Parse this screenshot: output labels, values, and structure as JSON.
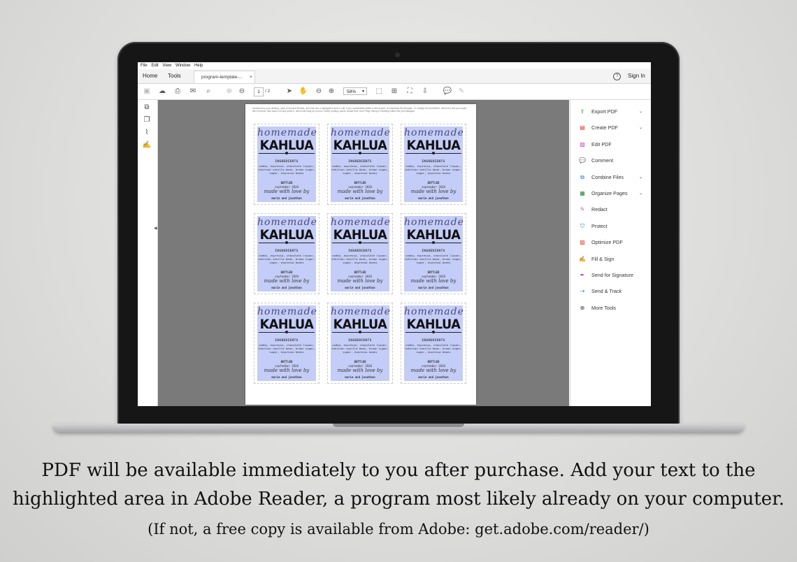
{
  "menu": [
    "File",
    "Edit",
    "View",
    "Window",
    "Help"
  ],
  "tabs": {
    "home": "Home",
    "tools": "Tools",
    "doc": "program-template-...",
    "close": "×"
  },
  "header": {
    "sign_in": "Sign In",
    "help": "?"
  },
  "toolbar": {
    "page_current": "1",
    "page_total": "/ 2",
    "zoom": "58%"
  },
  "page_instructions": "Download to your desktop, open in Acrobat Reader, and click into a highlighted area to edit. If you accidentally delete a font accent, re-download the template. To change the font/theme, select the text you would like to format, hold down Ctrl and press E, which will bring up a menu. When printing, select 'Actual Size' from 'Page Sizing & Handling' within the print dialogue.",
  "label": {
    "script": "homemade",
    "title": "KAHLUA",
    "ingredients_heading": "INGREDIENTS",
    "ingredients": "vodka, espresso, chocolate liquor, tahitian vanilla bean, brown sugar, sugar, espresso beans",
    "bottled_heading": "BOTTLED",
    "bottled_date": "september 2020",
    "love_line": "made with love by",
    "names": "marie and jonathon"
  },
  "labels_count": 9,
  "tools": [
    {
      "label": "Export PDF",
      "icon": "export-pdf-icon",
      "color": "#2b8a3e",
      "caret": true
    },
    {
      "label": "Create PDF",
      "icon": "create-pdf-icon",
      "color": "#d9342b",
      "caret": true
    },
    {
      "label": "Edit PDF",
      "icon": "edit-pdf-icon",
      "color": "#c43ec9",
      "caret": false
    },
    {
      "label": "Comment",
      "icon": "comment-icon",
      "color": "#f0b400",
      "caret": false
    },
    {
      "label": "Combine Files",
      "icon": "combine-files-icon",
      "color": "#1473e6",
      "caret": true
    },
    {
      "label": "Organize Pages",
      "icon": "organize-pages-icon",
      "color": "#2b8a3e",
      "caret": true
    },
    {
      "label": "Redact",
      "icon": "redact-icon",
      "color": "#d94bb5",
      "caret": false
    },
    {
      "label": "Protect",
      "icon": "protect-icon",
      "color": "#1473e6",
      "caret": false
    },
    {
      "label": "Optimize PDF",
      "icon": "optimize-pdf-icon",
      "color": "#d9342b",
      "caret": false
    },
    {
      "label": "Fill & Sign",
      "icon": "fill-sign-icon",
      "color": "#7b3fd1",
      "caret": false
    },
    {
      "label": "Send for Signature",
      "icon": "send-signature-icon",
      "color": "#7b3fd1",
      "caret": false
    },
    {
      "label": "Send & Track",
      "icon": "send-track-icon",
      "color": "#1473e6",
      "caret": false
    },
    {
      "label": "More Tools",
      "icon": "more-tools-icon",
      "color": "#444444",
      "caret": false
    }
  ],
  "caption": {
    "line1": "PDF will be available immediately to you after purchase.  Add your text to the",
    "line2": "highlighted area in Adobe Reader, a program most likely already on your computer.",
    "line3": "(If not, a free copy is available from Adobe: get.adobe.com/reader/)"
  }
}
